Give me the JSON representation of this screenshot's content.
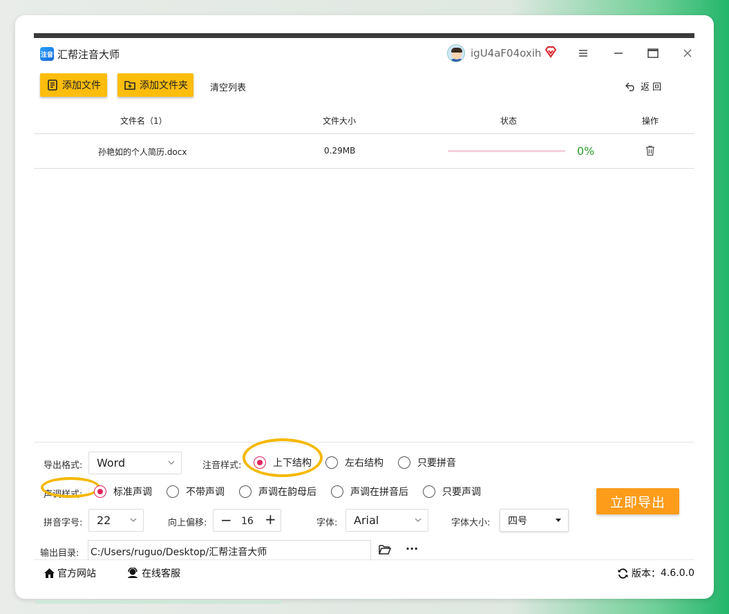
{
  "app": {
    "title": "汇帮注音大师",
    "logo_text": "注音",
    "username": "igU4aF04oxih",
    "icons": [
      "app-logo",
      "avatar",
      "vip-diamond",
      "menu",
      "minimize",
      "maximize",
      "close"
    ]
  },
  "toolbar": {
    "add_file": "添加文件",
    "add_folder": "添加文件夹",
    "clear_list": "清空列表",
    "back": "返 回"
  },
  "table": {
    "headers": {
      "filename": "文件名（1）",
      "filesize": "文件大小",
      "status": "状态",
      "action": "操作"
    },
    "rows": [
      {
        "filename": "孙艳如的个人简历.docx",
        "size": "0.29MB",
        "progress": 0,
        "percent": "0%"
      }
    ]
  },
  "settings": {
    "export_format_label": "导出格式:",
    "export_format_value": "Word",
    "annotation_style_label": "注音样式:",
    "annotation_options": [
      "上下结构",
      "左右结构",
      "只要拼音"
    ],
    "annotation_selected": "上下结构",
    "tone_style_label": "声调样式:",
    "tone_options": [
      "标准声调",
      "不带声调",
      "声调在韵母后",
      "声调在拼音后",
      "只要声调"
    ],
    "tone_selected": "标准声调",
    "pinyin_size_label": "拼音字号:",
    "pinyin_size_value": "22",
    "offset_label": "向上偏移:",
    "offset_value": "16",
    "font_label": "字体:",
    "font_value": "Arial",
    "font_size_label": "字体大小:",
    "font_size_value": "四号",
    "output_dir_label": "输出目录:",
    "output_dir_value": "C:/Users/ruguo/Desktop/汇帮注音大师",
    "export_button": "立即导出",
    "more": "···"
  },
  "footer": {
    "website": "官方网站",
    "support": "在线客服",
    "version_label": "版本：",
    "version": "4.6.0.0"
  },
  "colors": {
    "primary_button": "#fdbd0d",
    "export_button": "#fd9c1b",
    "radio_checked": "#e0245e",
    "highlight_ring": "#f5b800",
    "percent_text": "#2a9d2a",
    "progress_track": "#f2d2da"
  }
}
